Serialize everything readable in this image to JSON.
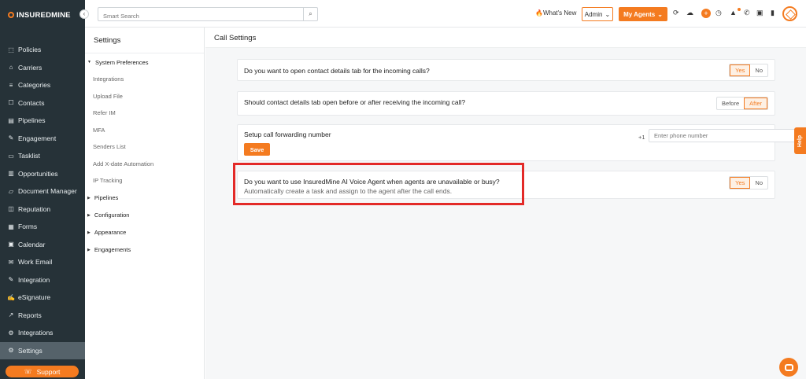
{
  "brand": {
    "logo_text": "INSUREDMINE"
  },
  "icons": {
    "collapse": "chevron-left-icon",
    "search": "search-icon",
    "whats_new": "fire-icon"
  },
  "colors": {
    "accent": "#f47b20",
    "sidebar_bg": "#263238",
    "highlight": "#e32a28"
  },
  "nav": {
    "items": [
      {
        "label": "Policies",
        "icon": "⬚"
      },
      {
        "label": "Carriers",
        "icon": "⌂"
      },
      {
        "label": "Categories",
        "icon": "≡"
      },
      {
        "label": "Contacts",
        "icon": "☐"
      },
      {
        "label": "Pipelines",
        "icon": "▤"
      },
      {
        "label": "Engagement",
        "icon": "✎"
      },
      {
        "label": "Tasklist",
        "icon": "▭"
      },
      {
        "label": "Opportunities",
        "icon": "▥"
      },
      {
        "label": "Document Manager",
        "icon": "▱"
      },
      {
        "label": "Reputation",
        "icon": "◫"
      },
      {
        "label": "Forms",
        "icon": "▦"
      },
      {
        "label": "Calendar",
        "icon": "▣"
      },
      {
        "label": "Work Email",
        "icon": "✉"
      },
      {
        "label": "Integration",
        "icon": "✎"
      },
      {
        "label": "eSignature",
        "icon": "✍"
      },
      {
        "label": "Reports",
        "icon": "↗"
      },
      {
        "label": "Integrations",
        "icon": "⚙"
      },
      {
        "label": "Settings",
        "icon": "⚙"
      }
    ],
    "support_label": "Support"
  },
  "topbar": {
    "search_placeholder": "Smart Search",
    "whats_new": "What's New",
    "admin": "Admin",
    "my_agents": "My Agents"
  },
  "settings_panel": {
    "title": "Settings",
    "system_preferences": "System Preferences",
    "sub_items": [
      "Integrations",
      "Upload File",
      "Refer IM",
      "MFA",
      "Senders List",
      "Add X-date Automation",
      "IP Tracking"
    ],
    "sections": [
      "Pipelines",
      "Configuration",
      "Appearance",
      "Engagements"
    ]
  },
  "main": {
    "header": "Call Settings",
    "q1": {
      "text": "Do you want to open contact details tab for the incoming calls?",
      "yes": "Yes",
      "no": "No"
    },
    "q2": {
      "text": "Should contact details tab open before or after receiving the incoming call?",
      "before": "Before",
      "after": "After"
    },
    "q3": {
      "text": "Setup call forwarding number",
      "prefix": "+1",
      "placeholder": "Enter phone number",
      "save": "Save"
    },
    "q4": {
      "text": "Do you want to use InsuredMine AI Voice Agent when agents are unavailable or busy?",
      "sub": "Automatically create a task and assign to the agent after the call ends.",
      "yes": "Yes",
      "no": "No"
    }
  },
  "help_label": "Help"
}
